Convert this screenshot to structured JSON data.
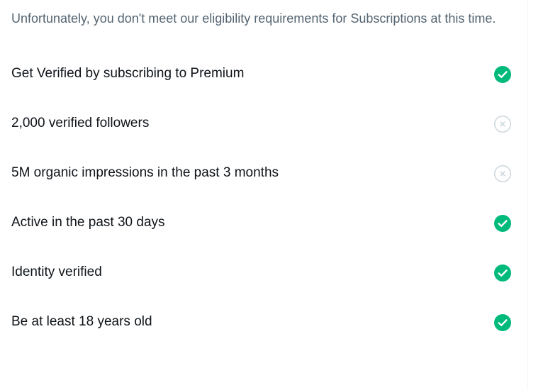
{
  "notice": "Unfortunately, you don't meet our eligibility requirements for Subscriptions at this time.",
  "colors": {
    "met": "#00ba7c",
    "unmet": "#cfd9de",
    "text_primary": "#0f1419",
    "text_secondary": "#536471"
  },
  "requirements": [
    {
      "label": "Get Verified by subscribing to Premium",
      "met": true,
      "icon": "check-circle-icon"
    },
    {
      "label": "2,000 verified followers",
      "met": false,
      "icon": "x-circle-icon"
    },
    {
      "label": "5M organic impressions in the past 3 months",
      "met": false,
      "icon": "x-circle-icon"
    },
    {
      "label": "Active in the past 30 days",
      "met": true,
      "icon": "check-circle-icon"
    },
    {
      "label": "Identity verified",
      "met": true,
      "icon": "check-circle-icon"
    },
    {
      "label": "Be at least 18 years old",
      "met": true,
      "icon": "check-circle-icon"
    }
  ]
}
